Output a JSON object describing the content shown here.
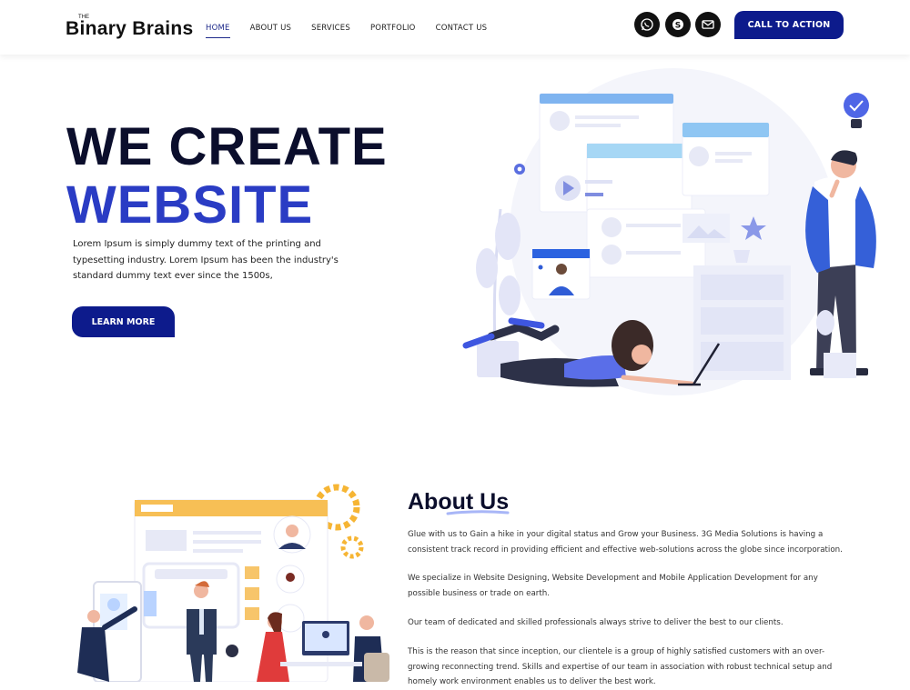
{
  "header": {
    "logo_small": "THE",
    "logo_text": "Binary Brains",
    "nav": [
      {
        "label": "HOME",
        "active": true
      },
      {
        "label": "ABOUT US",
        "active": false
      },
      {
        "label": "SERVICES",
        "active": false
      },
      {
        "label": "PORTFOLIO",
        "active": false
      },
      {
        "label": "CONTACT US",
        "active": false
      }
    ],
    "social_icons": [
      "whatsapp-icon",
      "skype-icon",
      "mail-icon"
    ],
    "cta_label": "CALL TO ACTION"
  },
  "hero": {
    "title_line1": "WE CREATE",
    "title_line2": "WEBSITE",
    "text": "Lorem Ipsum is simply dummy text of the printing and typesetting industry. Lorem Ipsum has been the industry's standard dummy text ever since the 1500s,",
    "button_label": "LEARN MORE"
  },
  "about": {
    "title": "About Us",
    "paragraphs": [
      "Glue with us to Gain a hike in your digital status and Grow your Business. 3G Media Solutions is having a consistent track record in providing efficient and effective web-solutions across the globe since incorporation.",
      "We specialize in Website Designing, Website Development and Mobile Application Development for any possible business or trade on earth.",
      "Our team of dedicated and skilled professionals always strive to deliver the best to our clients.",
      "This is the reason that since inception, our clientele is a group of highly satisfied customers with an over-growing reconnecting trend. Skills and expertise of our team in association with robust technical setup and homely work environment enables us to deliver the best work."
    ]
  },
  "colors": {
    "primary": "#0d1b8c",
    "accent_blue": "#2a3cc4",
    "dark_text": "#0b0e2c"
  }
}
